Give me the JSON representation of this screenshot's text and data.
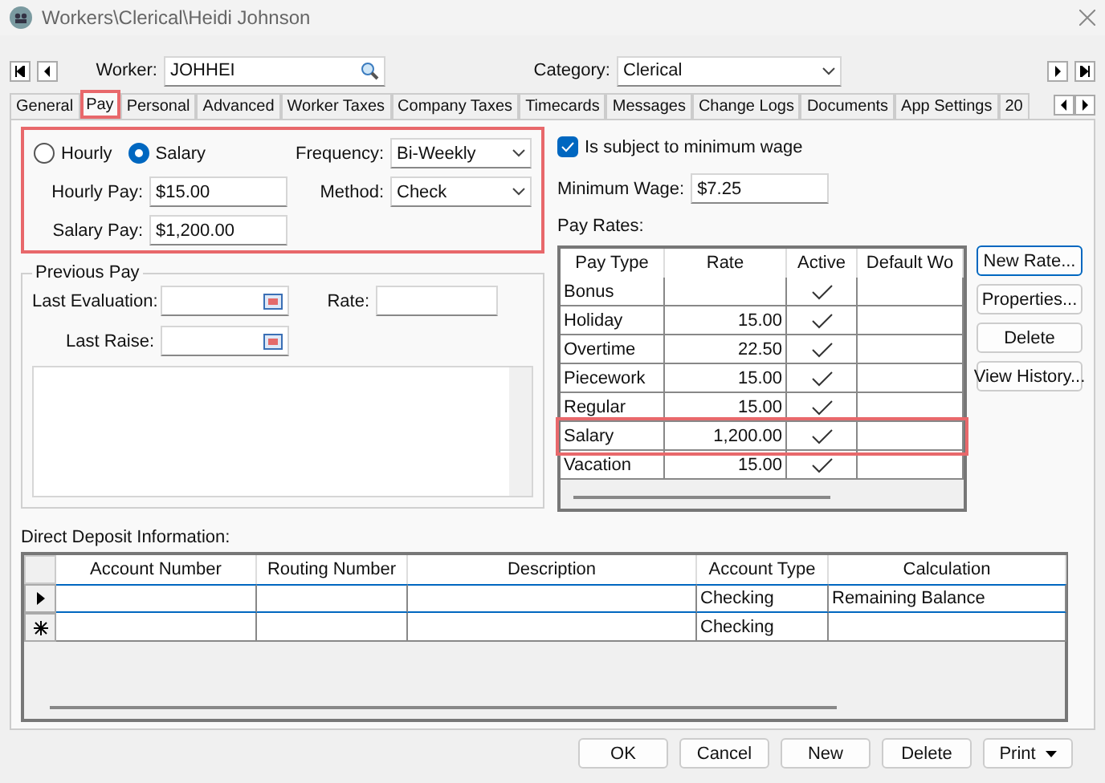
{
  "window": {
    "title": "Workers\\Clerical\\Heidi Johnson"
  },
  "header": {
    "worker_label": "Worker:",
    "worker": "JOHHEI",
    "category_label": "Category:",
    "category": "Clerical"
  },
  "tabs": [
    {
      "label": "General",
      "selected": false,
      "highlighted": false
    },
    {
      "label": "Pay",
      "selected": true,
      "highlighted": true
    },
    {
      "label": "Personal",
      "selected": false,
      "highlighted": false
    },
    {
      "label": "Advanced",
      "selected": false,
      "highlighted": false
    },
    {
      "label": "Worker Taxes",
      "selected": false,
      "highlighted": false
    },
    {
      "label": "Company Taxes",
      "selected": false,
      "highlighted": false
    },
    {
      "label": "Timecards",
      "selected": false,
      "highlighted": false
    },
    {
      "label": "Messages",
      "selected": false,
      "highlighted": false
    },
    {
      "label": "Change Logs",
      "selected": false,
      "highlighted": false
    },
    {
      "label": "Documents",
      "selected": false,
      "highlighted": false
    },
    {
      "label": "App Settings",
      "selected": false,
      "highlighted": false
    },
    {
      "label": "20",
      "selected": false,
      "highlighted": false
    }
  ],
  "pay": {
    "highlighted": true,
    "pay_types": [
      {
        "label": "Hourly",
        "selected": false
      },
      {
        "label": "Salary",
        "selected": true
      }
    ],
    "hourly_pay_label": "Hourly Pay:",
    "hourly_pay": "$15.00",
    "salary_pay_label": "Salary Pay:",
    "salary_pay": "$1,200.00",
    "frequency_label": "Frequency:",
    "frequency": "Bi-Weekly",
    "method_label": "Method:",
    "method": "Check"
  },
  "previous_pay": {
    "title": "Previous Pay",
    "last_evaluation_label": "Last Evaluation:",
    "rate_label": "Rate:",
    "last_raise_label": "Last Raise:"
  },
  "minimum_wage": {
    "checkbox_label": "Is subject to minimum wage",
    "checked": true,
    "label": "Minimum Wage:",
    "value": "$7.25"
  },
  "pay_rates": {
    "label": "Pay Rates:",
    "columns": [
      "Pay Type",
      "Rate",
      "Active",
      "Default Wo"
    ],
    "rows": [
      {
        "pay_type": "Bonus",
        "rate": "",
        "active": true,
        "highlighted": false
      },
      {
        "pay_type": "Holiday",
        "rate": "15.00",
        "active": true,
        "highlighted": false
      },
      {
        "pay_type": "Overtime",
        "rate": "22.50",
        "active": true,
        "highlighted": false
      },
      {
        "pay_type": "Piecework",
        "rate": "15.00",
        "active": true,
        "highlighted": false
      },
      {
        "pay_type": "Regular",
        "rate": "15.00",
        "active": true,
        "highlighted": false
      },
      {
        "pay_type": "Salary",
        "rate": "1,200.00",
        "active": true,
        "highlighted": true
      },
      {
        "pay_type": "Vacation",
        "rate": "15.00",
        "active": true,
        "highlighted": false
      }
    ],
    "buttons": [
      "New Rate...",
      "Properties...",
      "Delete",
      "View History..."
    ]
  },
  "direct_deposit": {
    "label": "Direct Deposit Information:",
    "columns": [
      "Account Number",
      "Routing Number",
      "Description",
      "Account Type",
      "Calculation"
    ],
    "rows": [
      {
        "kind": "current",
        "cells": [
          "",
          "",
          "",
          "Checking",
          "Remaining Balance"
        ]
      },
      {
        "kind": "new",
        "cells": [
          "",
          "",
          "",
          "Checking",
          ""
        ]
      }
    ]
  },
  "footer_buttons": [
    {
      "label": "OK",
      "kind": "plain"
    },
    {
      "label": "Cancel",
      "kind": "plain"
    },
    {
      "label": "New",
      "kind": "plain"
    },
    {
      "label": "Delete",
      "kind": "plain"
    },
    {
      "label": "Print",
      "kind": "menu"
    }
  ]
}
